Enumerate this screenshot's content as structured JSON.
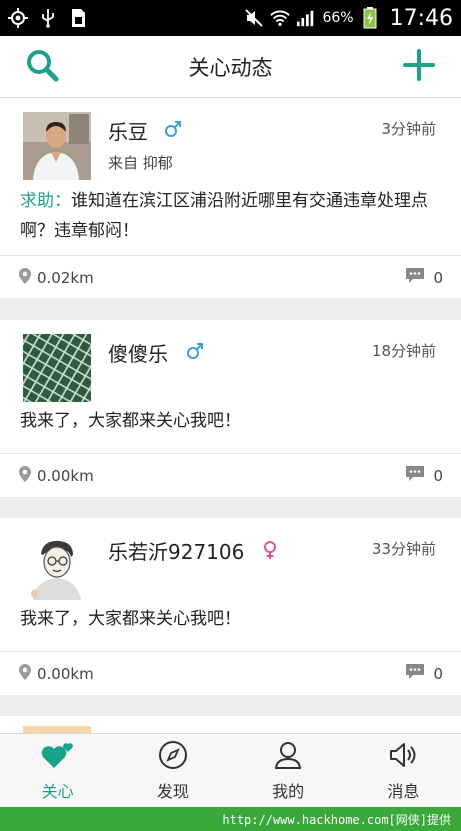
{
  "status_bar": {
    "battery_percent": "66%",
    "time": "17:46",
    "icons": [
      "gps-icon",
      "usb-icon",
      "sim-icon",
      "mute-icon",
      "wifi-icon",
      "signal-icon",
      "battery-charging-icon"
    ]
  },
  "app_bar": {
    "title": "关心动态",
    "left_icon": "search-icon",
    "right_icon": "plus-icon"
  },
  "feed": [
    {
      "user": "乐豆",
      "gender": "male",
      "time": "3分钟前",
      "from": "来自 抑郁",
      "tag": "求助：",
      "text": "谁知道在滨江区浦沿附近哪里有交通违章处理点啊？违章郁闷！",
      "distance": "0.02km",
      "comments": "0",
      "avatar": "photo-man-avatar"
    },
    {
      "user": "傻傻乐",
      "gender": "male",
      "time": "18分钟前",
      "text": "我来了，大家都来关心我吧！",
      "distance": "0.00km",
      "comments": "0",
      "avatar": "green-net-avatar"
    },
    {
      "user": "乐若沂927106",
      "gender": "female",
      "time": "33分钟前",
      "text": "我来了，大家都来关心我吧！",
      "distance": "0.00km",
      "comments": "0",
      "avatar": "cartoon-avatar"
    }
  ],
  "tabs": [
    {
      "label": "关心",
      "icon": "hearts-icon",
      "active": true
    },
    {
      "label": "发现",
      "icon": "compass-icon",
      "active": false
    },
    {
      "label": "我的",
      "icon": "person-icon",
      "active": false
    },
    {
      "label": "消息",
      "icon": "speaker-icon",
      "active": false
    }
  ],
  "watermark": "http://www.hackhome.com[网侠]提供",
  "colors": {
    "accent": "#1aa38a",
    "male": "#3aa0d8",
    "female": "#e0559c"
  }
}
